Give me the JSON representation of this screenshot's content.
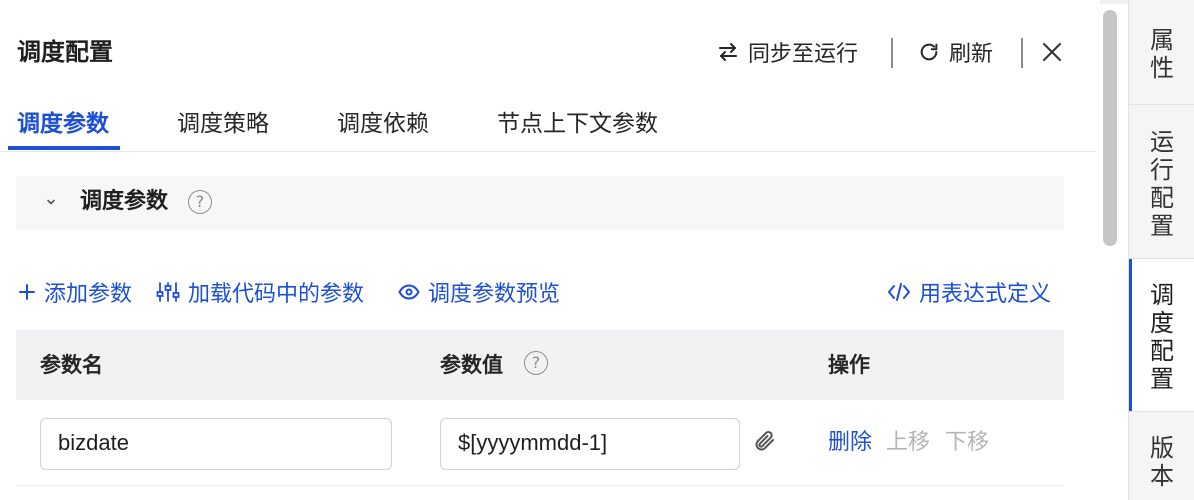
{
  "panel": {
    "title": "调度配置",
    "toolbar": {
      "sync_label": "同步至运行",
      "refresh_label": "刷新"
    }
  },
  "tabs": [
    {
      "label": "调度参数",
      "active": true
    },
    {
      "label": "调度策略",
      "active": false
    },
    {
      "label": "调度依赖",
      "active": false
    },
    {
      "label": "节点上下文参数",
      "active": false
    }
  ],
  "section": {
    "title": "调度参数",
    "help_glyph": "?"
  },
  "actions": {
    "add_param": "添加参数",
    "load_from_code": "加载代码中的参数",
    "preview": "调度参数预览",
    "expression_define": "用表达式定义"
  },
  "table": {
    "headers": {
      "name": "参数名",
      "value": "参数值",
      "ops": "操作"
    },
    "rows": [
      {
        "name": "bizdate",
        "value": "$[yyyymmdd-1]",
        "delete": "删除",
        "move_up": "上移",
        "move_down": "下移"
      }
    ]
  },
  "sidebar": {
    "items": [
      {
        "label": "属性",
        "chars": [
          "属",
          "性"
        ],
        "active": false
      },
      {
        "label": "运行配置",
        "chars": [
          "运",
          "行",
          "配",
          "置"
        ],
        "active": false
      },
      {
        "label": "调度配置",
        "chars": [
          "调",
          "度",
          "配",
          "置"
        ],
        "active": true
      },
      {
        "label": "版本",
        "chars": [
          "版",
          "本"
        ],
        "active": false
      }
    ]
  },
  "colors": {
    "accent": "#1d4fd7",
    "disabled": "#b5b5b5",
    "header_bg": "#f2f2f4"
  },
  "icons": [
    "sync-arrows-icon",
    "refresh-icon",
    "close-icon",
    "chevron-down-icon",
    "help-icon",
    "plus-icon",
    "sliders-icon",
    "eye-icon",
    "code-icon",
    "paperclip-icon"
  ]
}
